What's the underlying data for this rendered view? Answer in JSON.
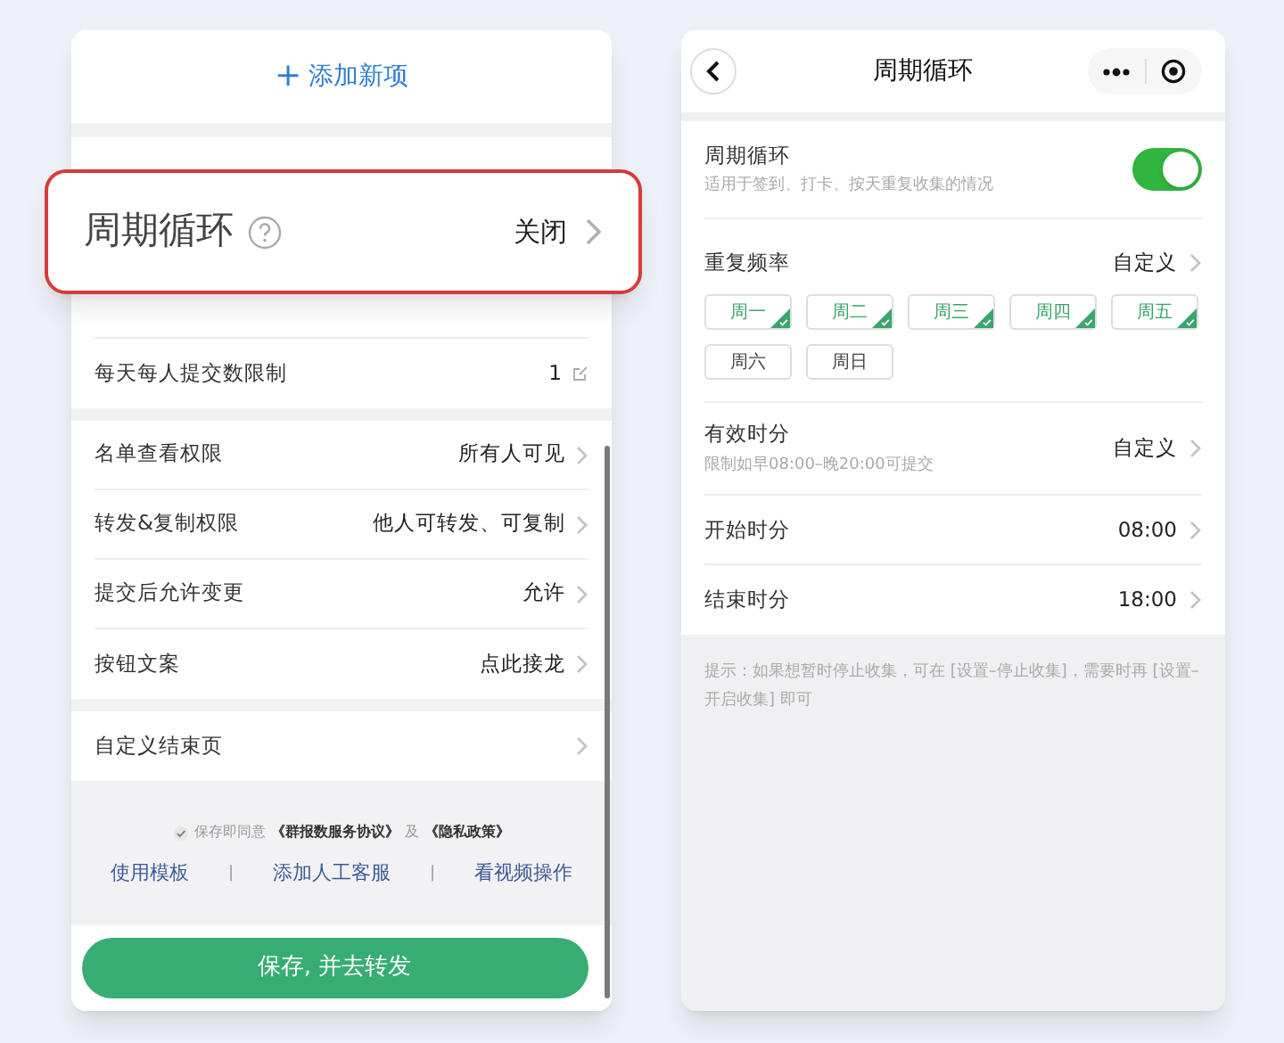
{
  "left_screen": {
    "add_item": {
      "icon": "+",
      "label": "添加新项"
    },
    "callout": {
      "label": "周期循环",
      "value": "关闭"
    },
    "groups": [
      [
        {
          "label": "每天每人提交数限制",
          "value": "1",
          "kind": "edit"
        }
      ],
      [
        {
          "label": "名单查看权限",
          "value": "所有人可见",
          "kind": "link"
        },
        {
          "label": "转发&复制权限",
          "value": "他人可转发、可复制",
          "kind": "link"
        },
        {
          "label": "提交后允许变更",
          "value": "允许",
          "kind": "link"
        },
        {
          "label": "按钮文案",
          "value": "点此接龙",
          "kind": "link"
        }
      ],
      [
        {
          "label": "自定义结束页",
          "kind": "link"
        }
      ]
    ],
    "agreement": {
      "checked": true,
      "text": "保存即同意",
      "links": [
        "《群报数服务协议》",
        "《隐私政策》"
      ],
      "joiner": "及"
    },
    "footer_links": [
      "使用模板",
      "添加人工客服",
      "看视频操作"
    ],
    "separator": "|",
    "save_button": "保存, 并去转发"
  },
  "right_screen": {
    "title": "周期循环",
    "cycle": {
      "label": "周期循环",
      "hint": "适用于签到、打卡、按天重复收集的情况",
      "on": true
    },
    "frequency": {
      "label": "重复频率",
      "value": "自定义"
    },
    "days": [
      {
        "label": "周一",
        "selected": true
      },
      {
        "label": "周二",
        "selected": true
      },
      {
        "label": "周三",
        "selected": true
      },
      {
        "label": "周四",
        "selected": true
      },
      {
        "label": "周五",
        "selected": true
      },
      {
        "label": "周六",
        "selected": false
      },
      {
        "label": "周日",
        "selected": false
      }
    ],
    "valid_time": {
      "label": "有效时分",
      "hint": "限制如早08:00–晚20:00可提交",
      "value": "自定义"
    },
    "times": [
      {
        "label": "开始时分",
        "value": "08:00"
      },
      {
        "label": "结束时分",
        "value": "18:00"
      }
    ],
    "tip": "提示：如果想暂时停止收集，可在 [设置–停止收集]，需要时再 [设置–开启收集] 即可"
  }
}
